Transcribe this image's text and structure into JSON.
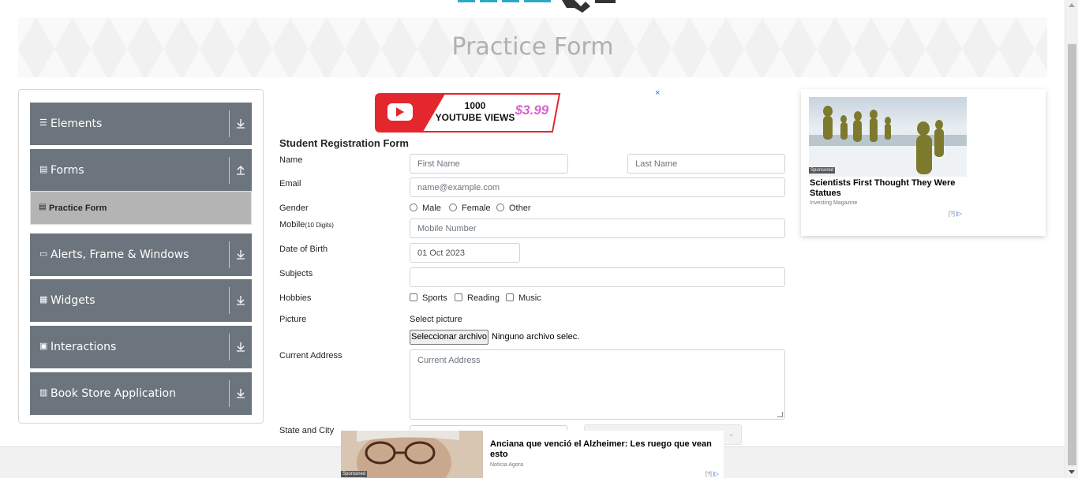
{
  "banner": {
    "title": "Practice Form"
  },
  "sidebar": {
    "groups": [
      {
        "label": "Elements",
        "icon": "menu-icon"
      },
      {
        "label": "Forms",
        "icon": "document-icon"
      },
      {
        "label": "Alerts, Frame & Windows",
        "icon": "window-icon"
      },
      {
        "label": "Widgets",
        "icon": "grid-icon"
      },
      {
        "label": "Interactions",
        "icon": "square-icon"
      },
      {
        "label": "Book Store Application",
        "icon": "books-icon"
      }
    ],
    "active_item": "Practice Form"
  },
  "form": {
    "title": "Student Registration Form",
    "name_label": "Name",
    "first_name_placeholder": "First Name",
    "last_name_placeholder": "Last Name",
    "email_label": "Email",
    "email_placeholder": "name@example.com",
    "gender_label": "Gender",
    "gender_options": [
      "Male",
      "Female",
      "Other"
    ],
    "mobile_label": "Mobile",
    "mobile_hint": "(10 Digits)",
    "mobile_placeholder": "Mobile Number",
    "dob_label": "Date of Birth",
    "dob_value": "01 Oct 2023",
    "subjects_label": "Subjects",
    "hobbies_label": "Hobbies",
    "hobbies_options": [
      "Sports",
      "Reading",
      "Music"
    ],
    "picture_label": "Picture",
    "picture_hint": "Select picture",
    "file_button": "Seleccionar archivo",
    "file_status": "Ninguno archivo selec.",
    "address_label": "Current Address",
    "address_placeholder": "Current Address",
    "state_city_label": "State and City"
  },
  "ads": {
    "top": {
      "text_line1": "1000",
      "text_line2": "YOUTUBE VIEWS",
      "price": "$3.99",
      "close": "×"
    },
    "right": {
      "sponsored": "Sponsored",
      "headline": "Scientists First Thought They Were Statues",
      "source": "Investing Magazine",
      "info": "[?]"
    },
    "bottom": {
      "sponsored": "Sponsored",
      "headline": "Anciana que venció el Alzheimer: Les ruego que vean esto",
      "source": "Notícia Agora",
      "info": "[?]"
    }
  },
  "colors": {
    "sidebar_bg": "#6c757d",
    "active_item_bg": "#b4b4b4",
    "banner_text": "#b0b0b0",
    "youtube_red": "#e4272d"
  }
}
